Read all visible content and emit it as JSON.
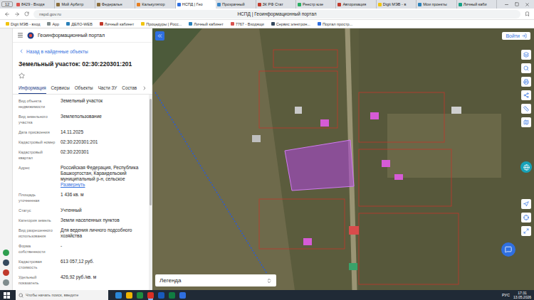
{
  "browser": {
    "tab_count": "12",
    "tabs": [
      {
        "label": "8429 - Входя",
        "selected": false,
        "color": "#d9534f"
      },
      {
        "label": "Мой Арбитр",
        "selected": false,
        "color": "#8a6d3b"
      },
      {
        "label": "Федеральн",
        "selected": false,
        "color": "#8a6d3b"
      },
      {
        "label": "Калькулятор",
        "selected": false,
        "color": "#e67e22"
      },
      {
        "label": "НСПД | Гео",
        "selected": true,
        "color": "#2f6fe0"
      },
      {
        "label": "Прозрачный",
        "selected": false,
        "color": "#3a87c8"
      },
      {
        "label": "ЗК РФ Стат",
        "selected": false,
        "color": "#c0392b"
      },
      {
        "label": "Реестр юзе",
        "selected": false,
        "color": "#27ae60"
      },
      {
        "label": "Авторизация",
        "selected": false,
        "color": "#c0392b"
      },
      {
        "label": "Digit МЭВ - в",
        "selected": false,
        "color": "#f1c40f"
      },
      {
        "label": "Мои проекты",
        "selected": false,
        "color": "#2980b9"
      },
      {
        "label": "Личный каби",
        "selected": false,
        "color": "#16a085"
      }
    ],
    "address": "nspd.gov.ru",
    "page_title": "НСПД | Геоинформационный портал",
    "bookmarks": [
      {
        "label": "Digit МЭВ - вход",
        "color": "#f1c40f"
      },
      {
        "label": "App",
        "color": "#7f8c8d"
      },
      {
        "label": "ДЕЛО-WEB",
        "color": "#2980b9"
      },
      {
        "label": "Личный кабинет",
        "color": "#c0392b"
      },
      {
        "label": "Процедуры | Росс...",
        "color": "#f1c40f"
      },
      {
        "label": "Личный кабинет",
        "color": "#2980b9"
      },
      {
        "label": "7767 - Входящи",
        "color": "#d9534f"
      },
      {
        "label": "Сервис электрон...",
        "color": "#34495e"
      },
      {
        "label": "Портал простр...",
        "color": "#2f6fe0"
      }
    ]
  },
  "portal": {
    "title": "Геоинформационный портал",
    "login": "Войти"
  },
  "panel": {
    "back": "Назад в найденные объекты",
    "heading": "Земельный участок: 02:30:220301:201",
    "favorite": false,
    "tabs": [
      {
        "label": "Информация",
        "selected": true
      },
      {
        "label": "Сервисы",
        "selected": false
      },
      {
        "label": "Объекты",
        "selected": false
      },
      {
        "label": "Части ЗУ",
        "selected": false
      },
      {
        "label": "Состав",
        "selected": false
      }
    ],
    "fields": [
      {
        "label": "Вид объекта недвижимости",
        "value": "Земельный участок"
      },
      {
        "label": "Вид земельного участка",
        "value": "Землепользование"
      },
      {
        "label": "Дата присвоения",
        "value": "14.11.2025"
      },
      {
        "label": "Кадастровый номер",
        "value": "02:30:220301:201"
      },
      {
        "label": "Кадастровый квартал",
        "value": "02:30:220301"
      },
      {
        "label": "Адрес",
        "value": "Российская Федерация, Республика Башкортостан, Караидельский муниципальный р-н, сельское",
        "link": "Развернуть"
      },
      {
        "label": "Площадь уточненная",
        "value": "1 436 кв. м"
      },
      {
        "label": "Статус",
        "value": "Учтенный"
      },
      {
        "label": "Категория земель",
        "value": "Земли населенных пунктов"
      },
      {
        "label": "Вид разрешенного использования",
        "value": "Для ведения личного подсобного хозяйства"
      },
      {
        "label": "Форма собственности",
        "value": "-"
      },
      {
        "label": "Кадастровая стоимость",
        "value": "613 057,12 руб."
      },
      {
        "label": "Удельный показатель",
        "value": "426,92 руб./кв. м"
      }
    ]
  },
  "map": {
    "legend": "Легенда"
  },
  "taskbar": {
    "search_placeholder": "Чтобы начать поиск, введите",
    "apps": [
      {
        "color": "#2b88d8",
        "active": false
      },
      {
        "color": "#f0b400",
        "active": false
      },
      {
        "color": "#1e8e3e",
        "active": false
      },
      {
        "color": "#d93025",
        "active": true
      },
      {
        "color": "#185abd",
        "active": false
      },
      {
        "color": "#107c41",
        "active": false
      },
      {
        "color": "#2f6fe0",
        "active": false
      }
    ],
    "language": "РУС",
    "time": "17:31",
    "date": "13.05.2026"
  }
}
